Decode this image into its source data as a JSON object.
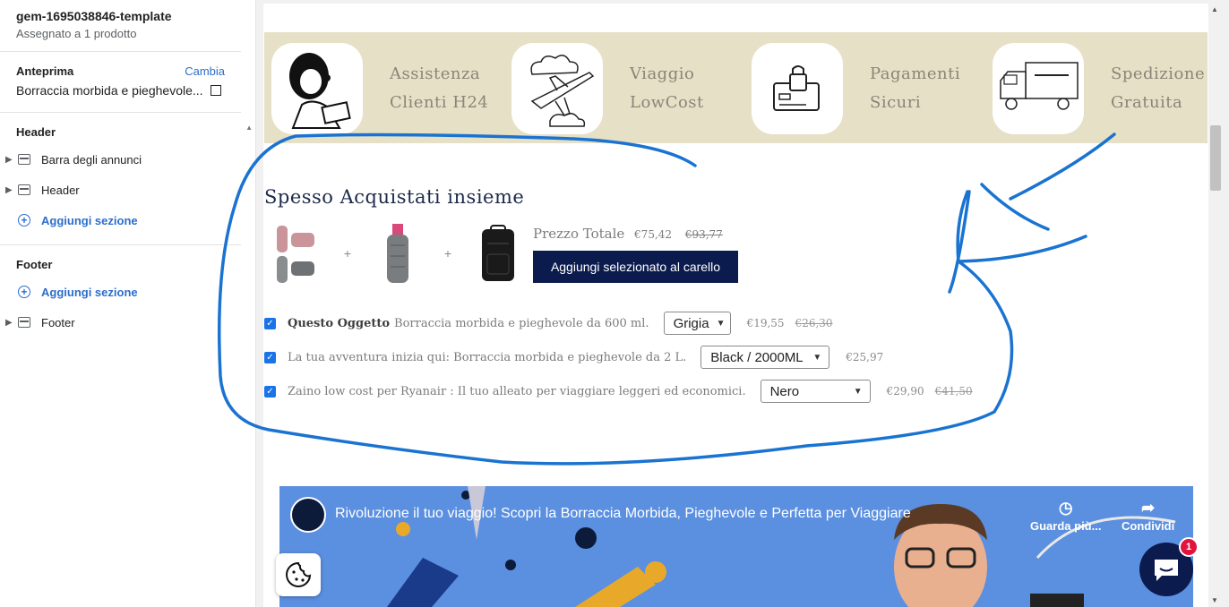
{
  "sidebar": {
    "template_name": "gem-1695038846-template",
    "assigned": "Assegnato a 1 prodotto",
    "preview_label": "Anteprima",
    "change_link": "Cambia",
    "preview_product": "Borraccia morbida e pieghevole...",
    "header_section": {
      "title": "Header",
      "items": [
        {
          "label": "Barra degli annunci",
          "icon": "section-icon"
        },
        {
          "label": "Header",
          "icon": "section-icon"
        }
      ],
      "add_label": "Aggiungi sezione"
    },
    "footer_section": {
      "title": "Footer",
      "add_label": "Aggiungi sezione",
      "items": [
        {
          "label": "Footer",
          "icon": "section-icon"
        }
      ]
    }
  },
  "features": [
    {
      "line1": "Assistenza",
      "line2": "Clienti H24",
      "icon": "headset-agent-icon"
    },
    {
      "line1": "Viaggio",
      "line2": "LowCost",
      "icon": "airplane-icon"
    },
    {
      "line1": "Pagamenti",
      "line2": "Sicuri",
      "icon": "secure-card-icon"
    },
    {
      "line1": "Spedizione",
      "line2": "Gratuita",
      "icon": "delivery-truck-icon"
    }
  ],
  "bundle": {
    "title": "Spesso Acquistati insieme",
    "total_label": "Prezzo Totale",
    "total_price": "€75,42",
    "total_old_price": "€93,77",
    "add_button": "Aggiungi selezionato al carello",
    "plus": "+",
    "items": [
      {
        "prefix": "Questo Oggetto",
        "name": "Borraccia morbida e pieghevole da 600 ml.",
        "option": "Grigia",
        "price": "€19,55",
        "old_price": "€26,30"
      },
      {
        "prefix": "",
        "name": "La tua avventura inizia qui: Borraccia morbida e pieghevole da 2 L.",
        "option": "Black / 2000ML",
        "price": "€25,97",
        "old_price": ""
      },
      {
        "prefix": "",
        "name": "Zaino low cost per Ryanair : Il tuo alleato per viaggiare leggeri ed economici.",
        "option": "Nero",
        "price": "€29,90",
        "old_price": "€41,50"
      }
    ]
  },
  "video": {
    "title": "Rivoluzione il tuo viaggio! Scopri la Borraccia Morbida, Pieghevole e Perfetta per Viaggiare",
    "watch_later": "Guarda più...",
    "share": "Condividi"
  },
  "chat_badge": "1",
  "colors": {
    "feature_band": "#e6e0c6",
    "button_navy": "#0b1b4d",
    "annotation_blue": "#1a73d1",
    "link_blue": "#2c6ecb"
  }
}
